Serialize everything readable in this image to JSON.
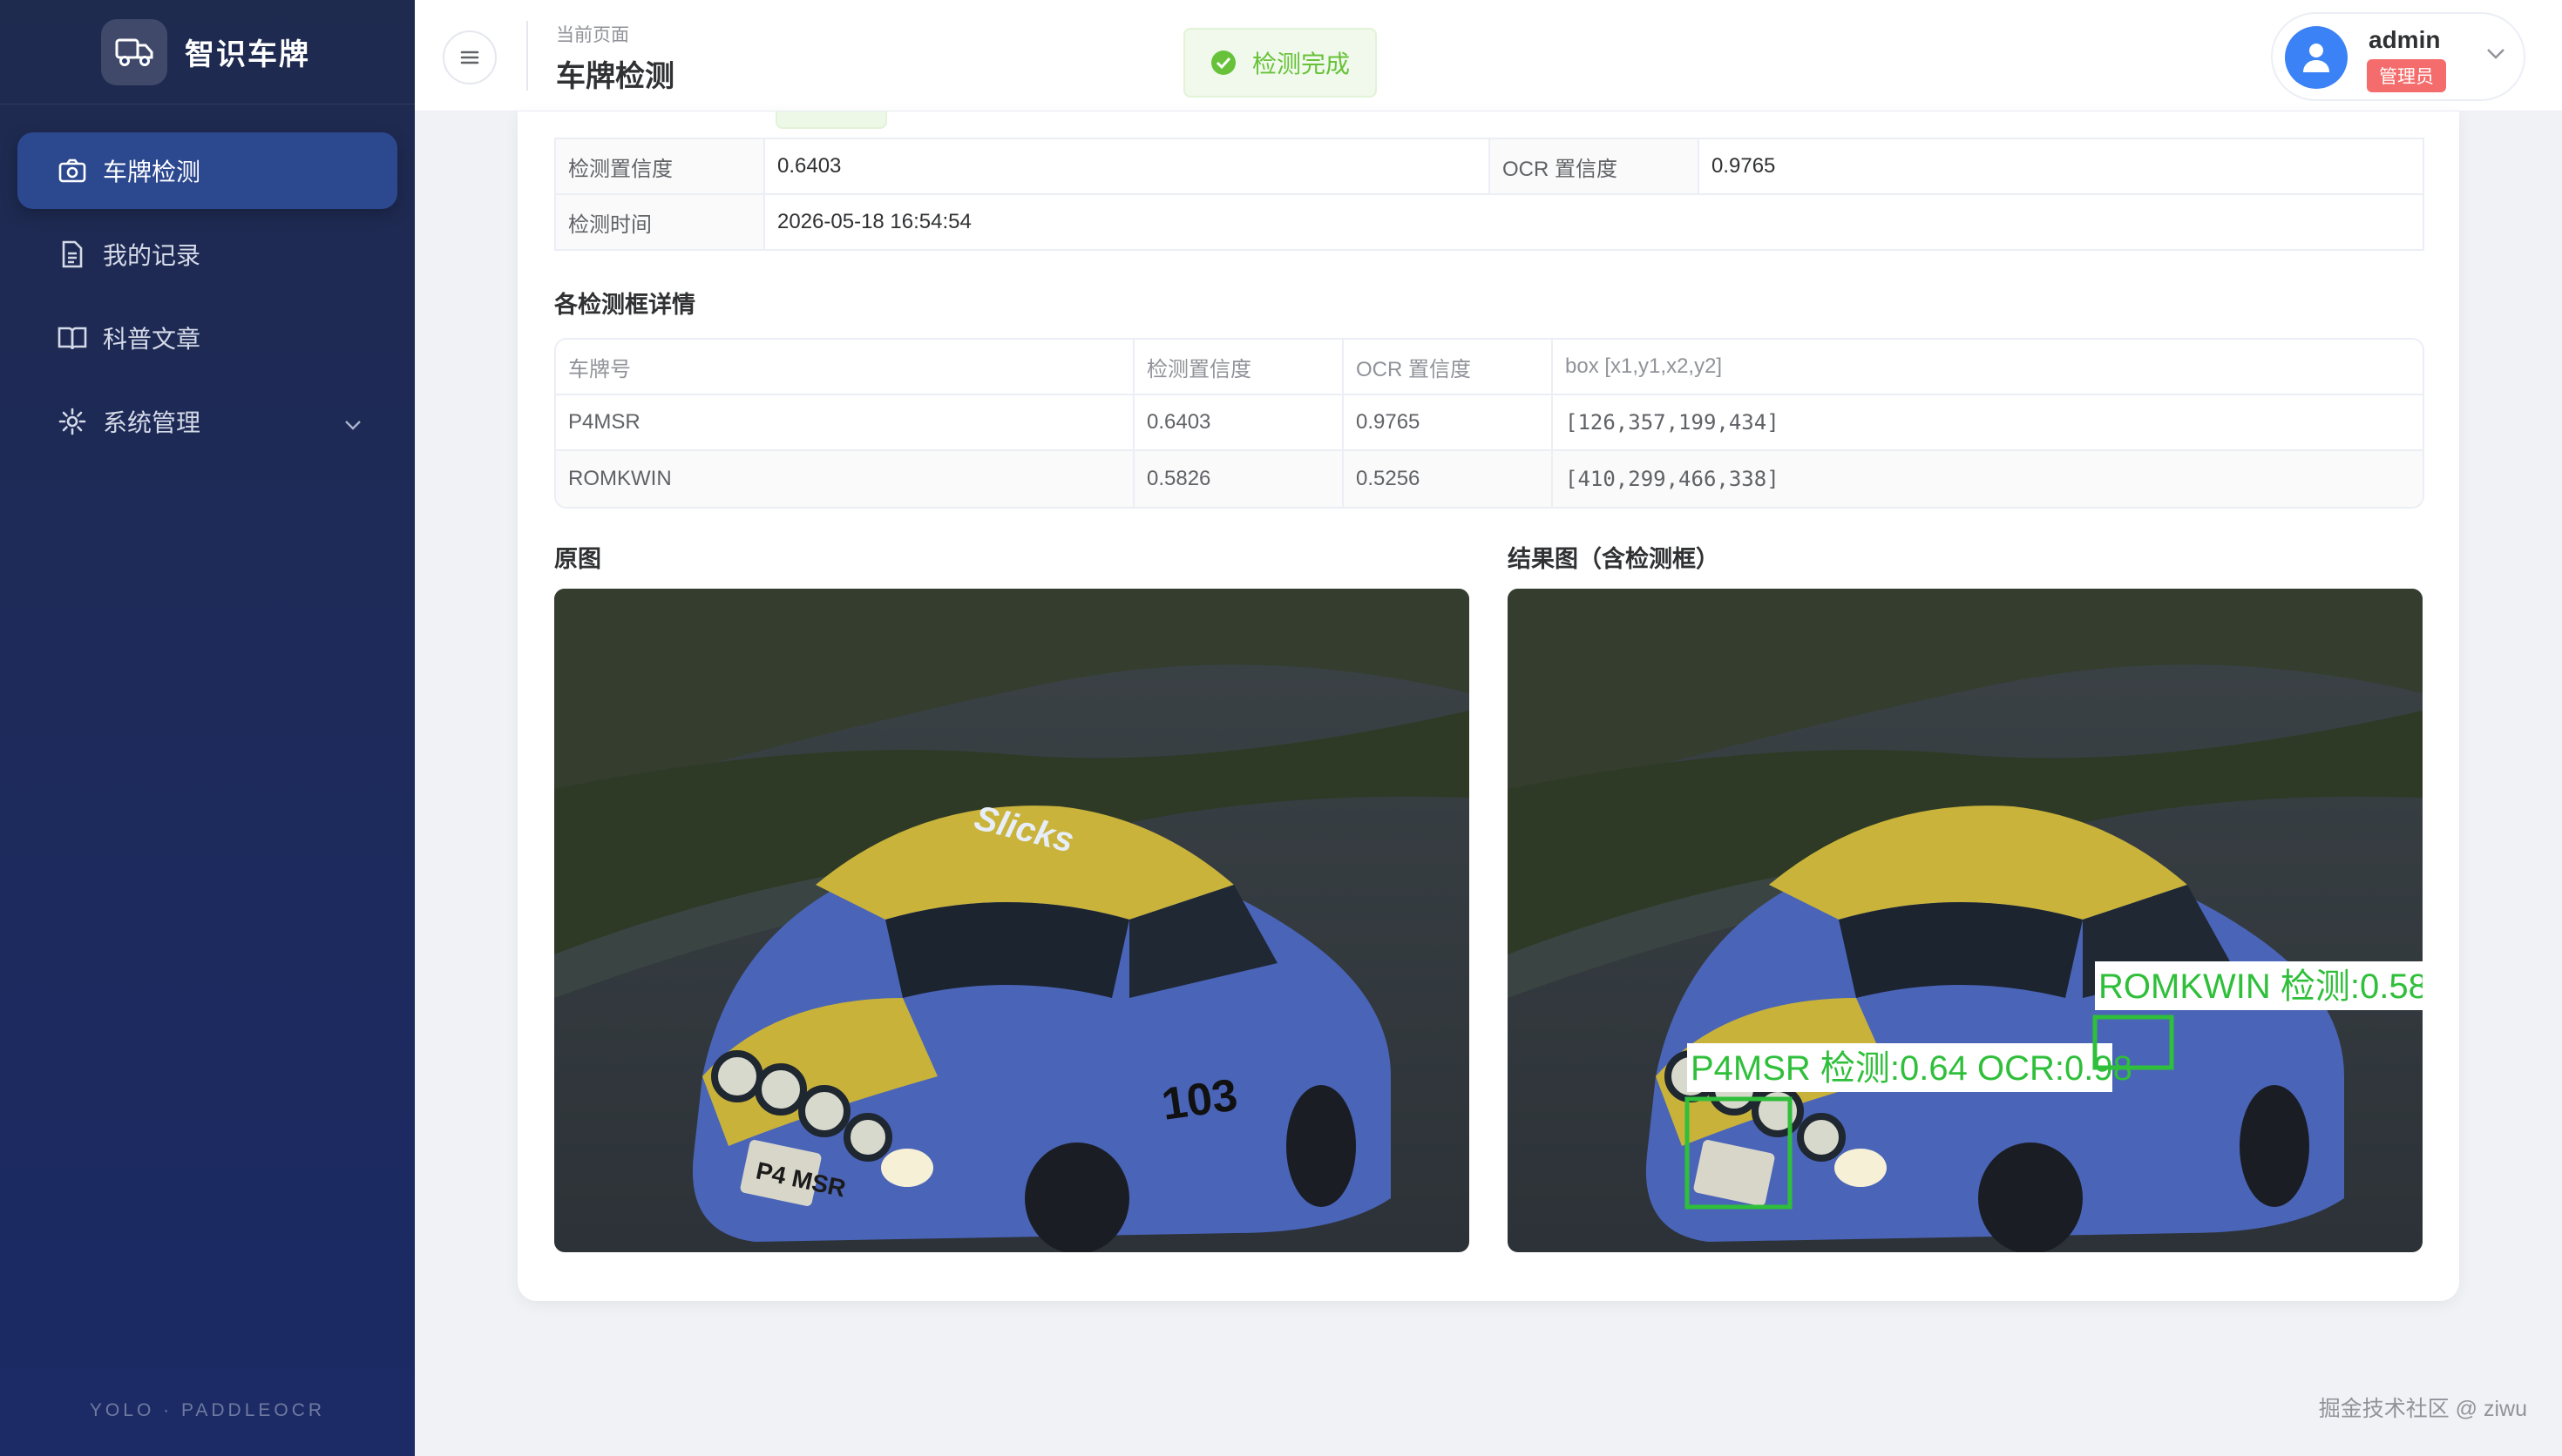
{
  "app": {
    "title": "智识车牌",
    "footer": "YOLO · PADDLEOCR"
  },
  "sidebar": {
    "items": [
      {
        "label": "车牌检测",
        "icon": "camera-icon",
        "active": true
      },
      {
        "label": "我的记录",
        "icon": "document-icon",
        "active": false
      },
      {
        "label": "科普文章",
        "icon": "book-icon",
        "active": false
      },
      {
        "label": "系统管理",
        "icon": "gear-icon",
        "active": false
      }
    ]
  },
  "header": {
    "crumb_label": "当前页面",
    "page_title": "车牌检测",
    "toast": "检测完成",
    "user": {
      "name": "admin",
      "role": "管理员"
    }
  },
  "summary": {
    "det_conf_label": "检测置信度",
    "det_conf_value": "0.6403",
    "ocr_conf_label": "OCR 置信度",
    "ocr_conf_value": "0.9765",
    "time_label": "检测时间",
    "time_value": "2026-05-18 16:54:54"
  },
  "detections": {
    "title": "各检测框详情",
    "headers": [
      "车牌号",
      "检测置信度",
      "OCR 置信度",
      "box [x1,y1,x2,y2]"
    ],
    "rows": [
      [
        "P4MSR",
        "0.6403",
        "0.9765",
        "[126,357,199,434]"
      ],
      [
        "ROMKWIN",
        "0.5826",
        "0.5256",
        "[410,299,466,338]"
      ]
    ]
  },
  "images": {
    "original_label": "原图",
    "result_label": "结果图（含检测框）",
    "box_labels": [
      "P4MSR 检测:0.64 OCR:0.98",
      "ROMKWIN 检测:0.58"
    ],
    "car_plate_text": "P4 MSR",
    "car_sponsor": "Slicks",
    "car_number": "103",
    "box_color": "#2fbf3a"
  },
  "watermark": "掘金技术社区 @ ziwu"
}
